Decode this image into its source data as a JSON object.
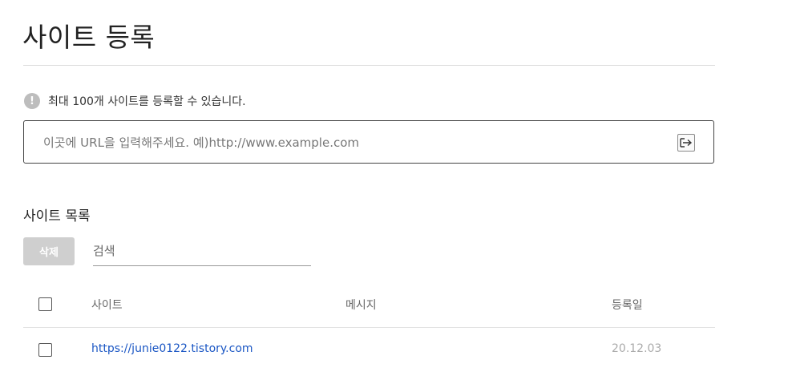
{
  "header": {
    "title": "사이트 등록"
  },
  "notice": {
    "icon": "exclamation-icon",
    "icon_glyph": "!",
    "text": "최대 100개 사이트를 등록할 수 있습니다."
  },
  "url_input": {
    "placeholder": "이곳에 URL을 입력해주세요. 예)http://www.example.com",
    "value": "",
    "submit_icon": "enter-arrow-icon"
  },
  "site_list": {
    "title": "사이트 목록",
    "delete_label": "삭제",
    "search_placeholder": "검색",
    "columns": [
      "사이트",
      "메시지",
      "등록일"
    ],
    "rows": [
      {
        "site": "https://junie0122.tistory.com",
        "message": "",
        "date": "20.12.03"
      }
    ]
  },
  "colors": {
    "link": "#1a56c4",
    "disabled_button": "#cfcfcf",
    "notice_icon": "#bdbdbd"
  }
}
